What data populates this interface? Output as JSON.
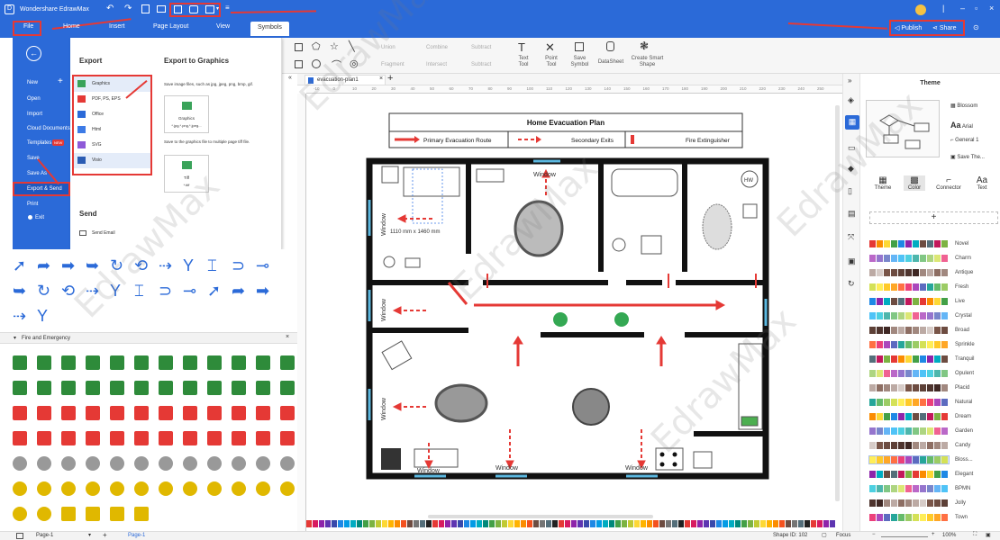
{
  "titlebar": {
    "app_title": "Wondershare EdrawMax"
  },
  "menu": {
    "file": "File",
    "tabs": [
      "Home",
      "Insert",
      "Page Layout",
      "View",
      "Symbols"
    ],
    "publish": "Publish",
    "share": "Share"
  },
  "ribbon": {
    "shapes_group": [
      "Union",
      "Combine",
      "Subtract",
      "Fragment",
      "Intersect",
      "Subtract"
    ],
    "text_tool": "Text\nTool",
    "point_tool": "Point\nTool",
    "save_symbol": "Save\nSymbol",
    "datasheet": "DataSheet",
    "create_smart": "Create Smart\nShape"
  },
  "file_menu": {
    "items": [
      "New",
      "Open",
      "Import",
      "Cloud Documents",
      "Templates",
      "Save",
      "Save As",
      "Export & Send",
      "Print",
      "Exit"
    ],
    "new_badge": "NEW"
  },
  "export_panel": {
    "export_title": "Export",
    "export_to_title": "Export to Graphics",
    "formats": [
      "Graphics",
      "PDF, PS, EPS",
      "Office",
      "Html",
      "SVG",
      "Visio"
    ],
    "desc1": "Save image files, such as jpg, jpeg, png, bmp, gif.",
    "graphics_label": "Graphics",
    "graphics_sub": "*.jpg,*.png,*.jpeg...",
    "desc2": "Save to the graphics file to multiple page tiff file.",
    "tiff_label": "Tiff",
    "tiff_sub": "*.tiff",
    "send_title": "Send",
    "send_email": "Send Email"
  },
  "library": {
    "category": "Fire and Emergency"
  },
  "canvas": {
    "tab": "evacuation-plan1",
    "plan_title": "Home Evacuation Plan",
    "legend": [
      "Primary Evacuation Route",
      "Secondary Exits",
      "Fire Extinguisher"
    ],
    "window": "Window",
    "dimension": "1110 mm x 1460 mm",
    "hw": "HW",
    "ruler_nums": [
      "-10",
      "0",
      "10",
      "20",
      "30",
      "40",
      "50",
      "60",
      "70",
      "80",
      "90",
      "100",
      "110",
      "120",
      "130",
      "140",
      "150",
      "160",
      "170",
      "180",
      "190",
      "200",
      "210",
      "220",
      "230",
      "240",
      "250"
    ]
  },
  "theme_panel": {
    "title": "Theme",
    "fonts": [
      "Blossom",
      "Arial",
      "General 1",
      "Save The..."
    ],
    "tabs": [
      "Theme",
      "Color",
      "Connector",
      "Text"
    ],
    "themes": [
      "Novel",
      "Charm",
      "Antique",
      "Fresh",
      "Live",
      "Crystal",
      "Broad",
      "Sprinkle",
      "Tranquil",
      "Opulent",
      "Placid",
      "Natural",
      "Dream",
      "Garden",
      "Candy",
      "Bloss...",
      "Elegant",
      "BPMN",
      "Jolly",
      "Town"
    ]
  },
  "status": {
    "page_select": "Page-1",
    "page_tab": "Page-1",
    "shape_id": "Shape ID: 102",
    "focus": "Focus",
    "zoom": "100%"
  },
  "watermark": "EdrawMax"
}
